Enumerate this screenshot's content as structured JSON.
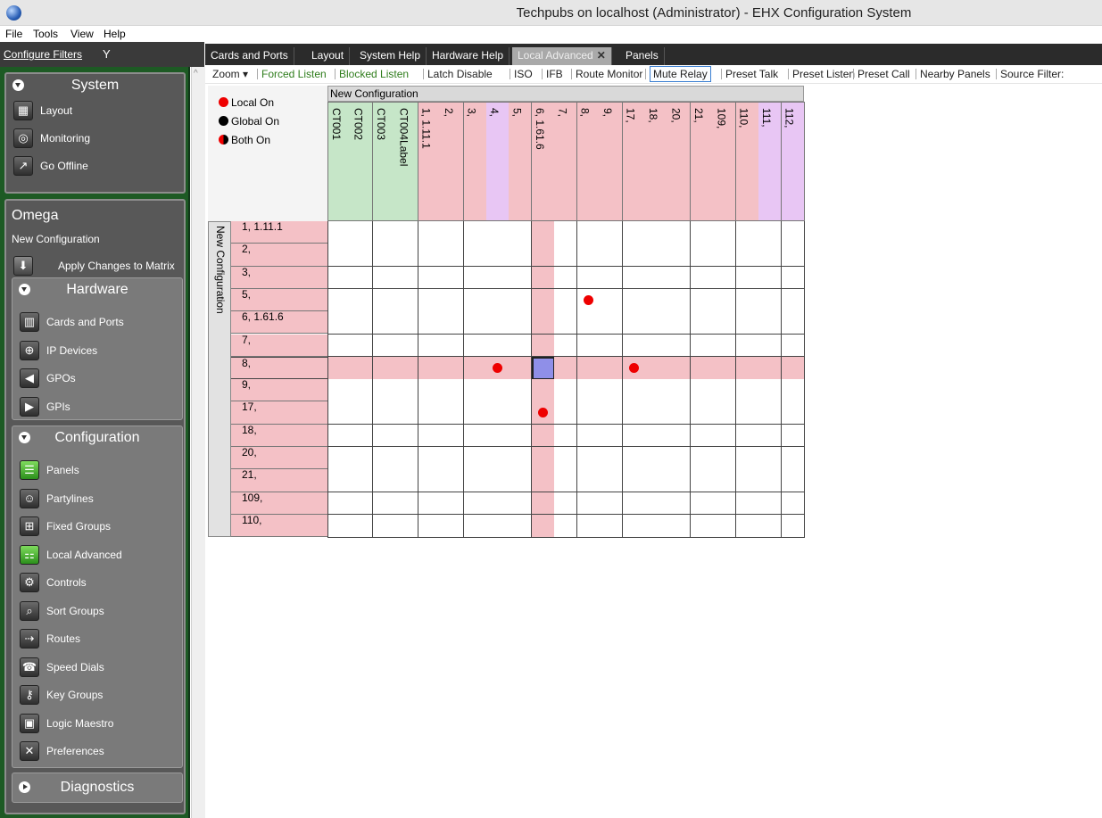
{
  "window": {
    "title": "Techpubs on localhost (Administrator) - EHX Configuration System"
  },
  "menu": [
    "File",
    "Tools",
    "View",
    "Help"
  ],
  "filter": {
    "label": "Configure Filters"
  },
  "tabs": [
    {
      "label": "Cards and Ports",
      "active": false
    },
    {
      "label": "Layout",
      "active": false
    },
    {
      "label": "System Help",
      "active": false
    },
    {
      "label": "Hardware Help",
      "active": false
    },
    {
      "label": "Local Advanced",
      "active": true,
      "closable": true
    },
    {
      "label": "Panels",
      "active": false
    }
  ],
  "toolbar": {
    "zoom": "Zoom",
    "items": [
      "Forced Listen",
      "Blocked Listen",
      "Latch Disable",
      "ISO",
      "IFB",
      "Route Monitor",
      "Mute Relay",
      "Preset Talk",
      "Preset Listen",
      "Preset Call",
      "Nearby Panels",
      "Source Filter:"
    ]
  },
  "sidebar": {
    "system": {
      "title": "System",
      "items": [
        {
          "label": "Layout",
          "icon": "layout-icon"
        },
        {
          "label": "Monitoring",
          "icon": "monitoring-icon"
        },
        {
          "label": "Go Offline",
          "icon": "go-offline-icon"
        }
      ]
    },
    "device": {
      "name": "Omega",
      "config": "New Configuration",
      "apply": "Apply Changes to Matrix"
    },
    "hardware": {
      "title": "Hardware",
      "items": [
        {
          "label": "Cards and Ports",
          "icon": "cards-ports-icon"
        },
        {
          "label": "IP Devices",
          "icon": "ip-devices-icon"
        },
        {
          "label": "GPOs",
          "icon": "gpo-icon"
        },
        {
          "label": "GPIs",
          "icon": "gpi-icon"
        }
      ]
    },
    "configuration": {
      "title": "Configuration",
      "items": [
        {
          "label": "Panels",
          "icon": "panels-icon"
        },
        {
          "label": "Partylines",
          "icon": "partylines-icon"
        },
        {
          "label": "Fixed Groups",
          "icon": "fixed-groups-icon"
        },
        {
          "label": "Local Advanced",
          "icon": "local-advanced-icon"
        },
        {
          "label": "Controls",
          "icon": "controls-icon"
        },
        {
          "label": "Sort Groups",
          "icon": "sort-groups-icon"
        },
        {
          "label": "Routes",
          "icon": "routes-icon"
        },
        {
          "label": "Speed Dials",
          "icon": "speed-dials-icon"
        },
        {
          "label": "Key Groups",
          "icon": "key-groups-icon"
        },
        {
          "label": "Logic Maestro",
          "icon": "logic-maestro-icon"
        },
        {
          "label": "Preferences",
          "icon": "preferences-icon"
        }
      ]
    },
    "diagnostics": {
      "title": "Diagnostics"
    }
  },
  "legend": [
    {
      "label": "Local On",
      "color": "#ee0000"
    },
    {
      "label": "Global On",
      "color": "#000000"
    },
    {
      "label": "Both On",
      "color": "split"
    }
  ],
  "matrix": {
    "group_label": "New Configuration",
    "row_group_label": "New Configuration",
    "columns": [
      {
        "label": "CT001",
        "color": "#c6e6c8"
      },
      {
        "label": "CT002",
        "color": "#c6e6c8"
      },
      {
        "label": "CT003",
        "color": "#c6e6c8"
      },
      {
        "label": "CT004Label",
        "color": "#c6e6c8"
      },
      {
        "label": "1, 1.11.1",
        "color": "#f4c1c6"
      },
      {
        "label": "2,",
        "color": "#f4c1c6"
      },
      {
        "label": "3,",
        "color": "#f4c1c6"
      },
      {
        "label": "4,",
        "color": "#e8c6f4"
      },
      {
        "label": "5,",
        "color": "#f4c1c6"
      },
      {
        "label": "6, 1.61.6",
        "color": "#f4c1c6"
      },
      {
        "label": "7,",
        "color": "#f4c1c6"
      },
      {
        "label": "8,",
        "color": "#f4c1c6"
      },
      {
        "label": "9,",
        "color": "#f4c1c6"
      },
      {
        "label": "17,",
        "color": "#f4c1c6"
      },
      {
        "label": "18,",
        "color": "#f4c1c6"
      },
      {
        "label": "20,",
        "color": "#f4c1c6"
      },
      {
        "label": "21,",
        "color": "#f4c1c6"
      },
      {
        "label": "109,",
        "color": "#f4c1c6"
      },
      {
        "label": "110,",
        "color": "#f4c1c6"
      },
      {
        "label": "111,",
        "color": "#e8c6f4"
      },
      {
        "label": "112,",
        "color": "#e8c6f4"
      }
    ],
    "rows": [
      "1, 1.11.1",
      "2,",
      "3,",
      "5,",
      "6, 1.61.6",
      "7,",
      "8,",
      "9,",
      "17,",
      "18,",
      "20,",
      "21,",
      "109,",
      "110,"
    ],
    "selected_row": 6,
    "selected_col": 9,
    "dots": [
      {
        "row": 3,
        "col": 11
      },
      {
        "row": 6,
        "col": 7
      },
      {
        "row": 6,
        "col": 13
      },
      {
        "row": 8,
        "col": 9
      }
    ]
  }
}
